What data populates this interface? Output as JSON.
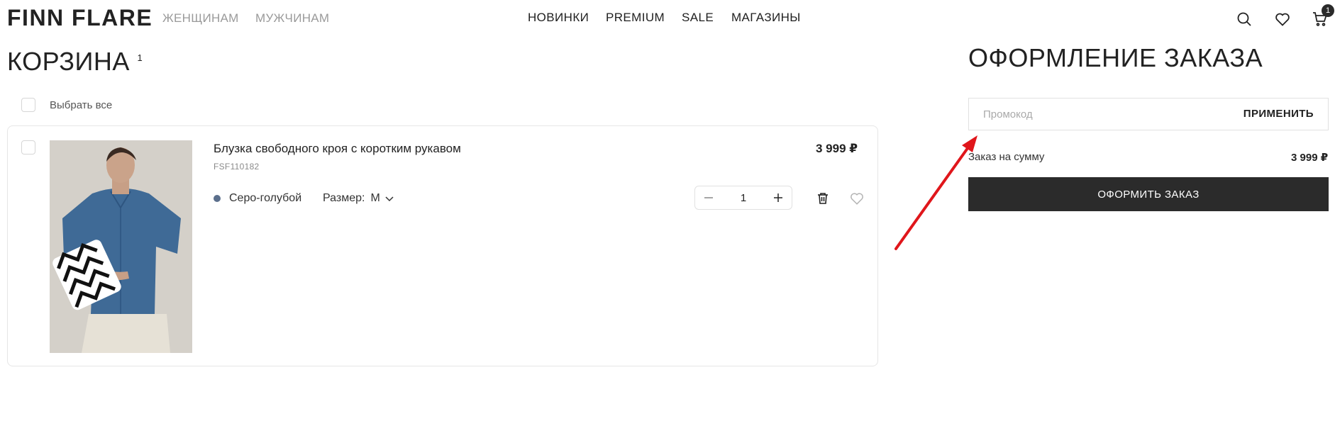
{
  "header": {
    "logo": "FINN FLARE",
    "nav_left": [
      "ЖЕНЩИНАМ",
      "МУЖЧИНАМ"
    ],
    "nav_center": [
      "НОВИНКИ",
      "PREMIUM",
      "SALE",
      "МАГАЗИНЫ"
    ],
    "icons": [
      "search-icon",
      "heart-icon",
      "cart-icon"
    ],
    "cart_count": "1"
  },
  "cart": {
    "title": "КОРЗИНА",
    "count": "1",
    "select_all_label": "Выбрать все",
    "items": [
      {
        "title": "Блузка свободного кроя с коротким рукавом",
        "sku": "FSF110182",
        "price": "3 999 ₽",
        "color_name": "Серо-голубой",
        "color_hex": "#5b6f8c",
        "size_label": "Размер:",
        "size_value": "M",
        "quantity": "1"
      }
    ]
  },
  "checkout": {
    "title": "ОФОРМЛЕНИЕ ЗАКАЗА",
    "promo_placeholder": "Промокод",
    "promo_apply": "ПРИМЕНИТЬ",
    "sum_label": "Заказ на сумму",
    "sum_value": "3 999 ₽",
    "submit_label": "ОФОРМИТЬ ЗАКАЗ"
  },
  "colors": {
    "accent_dark": "#2b2b2b",
    "annotation_arrow": "#e0161b"
  }
}
